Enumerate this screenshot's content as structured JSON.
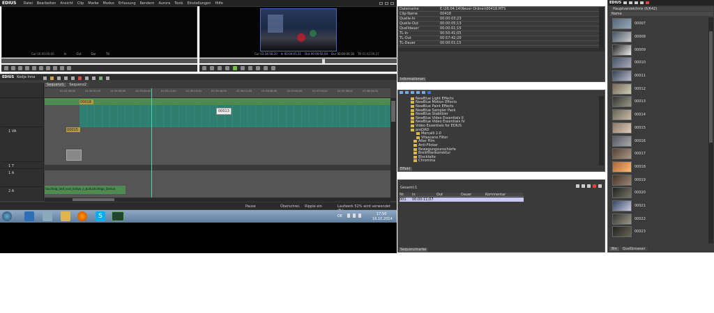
{
  "app": {
    "logo": "EDIUS",
    "menus": [
      "Datei",
      "Bearbeiten",
      "Ansicht",
      "Clip",
      "Marke",
      "Modus",
      "Erfassung",
      "Rendern",
      "Aurora",
      "Tools",
      "Einstellungen",
      "Hilfe"
    ]
  },
  "player": {
    "labels": [
      "Cur",
      "In",
      "Out",
      "Dur",
      "Ttl"
    ],
    "values": [
      "00:00:00;00",
      "",
      "",
      "",
      ""
    ]
  },
  "recorder": {
    "labels": [
      "Cur",
      "In",
      "Out",
      "Dur",
      "Ttl"
    ],
    "values": [
      "01:34:56;10",
      "00:00:01;11",
      "00:00:02;04",
      "00:00:00;18",
      "01:42:00;27"
    ]
  },
  "timeline": {
    "logo": "EDIUS",
    "project": "Kodja Inna",
    "tabs": [
      "Sequenz1",
      "Sequenz2"
    ],
    "ruler": [
      "01:34:36;00",
      "01:34:52;00",
      "01:34:58;00",
      "01:35:04;00",
      "01:35:12;00",
      "01:35:20;00",
      "01:35:46;00",
      "01:36:12;00",
      "01:36:38;00",
      "01:37:04;00",
      "01:37:20;00",
      "01:37:56;00",
      "01:38:04;00"
    ],
    "tracks": [
      "1 VA",
      "1 T",
      "1 A",
      "2 A"
    ],
    "clips": {
      "c1": "00018",
      "c2": "00013",
      "c3": "00015",
      "audio": "touching_and_suni_kodya_a_budushchego_1kmun"
    },
    "status": {
      "pause": "Pause",
      "overwrite": "Überschrei.",
      "ripple": "Ripple ein",
      "disk": "Laufwerk 52% wird verwendet (E:)"
    }
  },
  "taskbar": {
    "lang": "DE",
    "time": "17:50",
    "date": "16.10.2014"
  },
  "info": {
    "rows": [
      [
        "Dateiname",
        "E:\\26.04.14\\Neuer Ordner\\00418.MTS"
      ],
      [
        "Clip-Name",
        "00418"
      ],
      [
        "Quelle-In",
        "00:00:03;23"
      ],
      [
        "Quelle-Out",
        "00:00:05;13"
      ],
      [
        "Quelldauer",
        "00:00:01;15"
      ],
      [
        "TL-In",
        "00:50:41;05"
      ],
      [
        "TL-Out",
        "00:57:42;20"
      ],
      [
        "TL-Dauer",
        "00:00:01;15"
      ]
    ],
    "tab": "Informationen"
  },
  "effects": {
    "items": [
      "NewBlue Light Effects",
      "NewBlue Motion Effects",
      "NewBlue Paint Effects",
      "NewBlue Sampler Pack",
      "NewBlue Stabilizer",
      "NewBlue Video Essentials II",
      "NewBlue Video Essentials IV",
      "Video Essentials for EDIUS",
      "proDAD",
      "Mercalli 2.0",
      "Vitascene Filter",
      "Alter Film",
      "Anti-Flicker",
      "Bewegungsunschärfe",
      "Breitfilterkorrektur",
      "Blockfalte",
      "Chromina"
    ],
    "tab": "Effekt"
  },
  "markers": {
    "title": "Gesamt:1",
    "headers": [
      "Nr.",
      "In",
      "Out",
      "Dauer",
      "Kommentar"
    ],
    "row": [
      "001",
      "00:00:11;07",
      "",
      "",
      ""
    ],
    "tab": "Sequenzmarke"
  },
  "bin": {
    "logo": "EDIUS",
    "title": "Hauptverzeichnis (6/642)",
    "header": "Name",
    "items": [
      "00007",
      "00008",
      "00009",
      "00010",
      "00011",
      "00012",
      "00013",
      "00014",
      "00015",
      "00016",
      "00017",
      "00018",
      "00019",
      "00020",
      "00021",
      "00022",
      "00023"
    ],
    "tabs": [
      "Bin",
      "Quellbrowser"
    ]
  }
}
